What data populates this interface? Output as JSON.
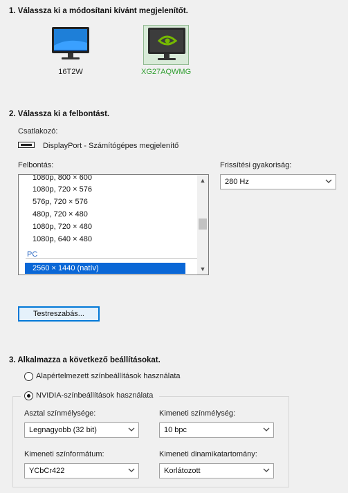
{
  "step1": {
    "title": "1. Válassza ki a módosítani kívánt megjelenítőt.",
    "displays": [
      {
        "name": "16T2W",
        "selected": false
      },
      {
        "name": "XG27AQWMG",
        "selected": true
      }
    ]
  },
  "step2": {
    "title": "2. Válassza ki a felbontást.",
    "connector_label": "Csatlakozó:",
    "connector_value": "DisplayPort - Számítógépes megjelenítő",
    "resolution_label": "Felbontás:",
    "resolutions": [
      "1080p, 800 × 600",
      "1080p, 720 × 576",
      "576p, 720 × 576",
      "480p, 720 × 480",
      "1080p, 720 × 480",
      "1080p, 640 × 480"
    ],
    "pc_group": "PC",
    "selected_resolution": "2560 × 1440 (natív)",
    "refresh_label": "Frissítési gyakoriság:",
    "refresh_value": "280 Hz",
    "customize_button": "Testreszabás..."
  },
  "step3": {
    "title": "3. Alkalmazza a következő beállításokat.",
    "radio_default": "Alapértelmezett színbeállítások használata",
    "radio_nvidia": "NVIDIA-színbeállítások használata",
    "desktop_depth_label": "Asztal színmélysége:",
    "desktop_depth_value": "Legnagyobb (32 bit)",
    "output_depth_label": "Kimeneti színmélység:",
    "output_depth_value": "10 bpc",
    "output_format_label": "Kimeneti színformátum:",
    "output_format_value": "YCbCr422",
    "output_range_label": "Kimeneti dinamikatartomány:",
    "output_range_value": "Korlátozott"
  }
}
